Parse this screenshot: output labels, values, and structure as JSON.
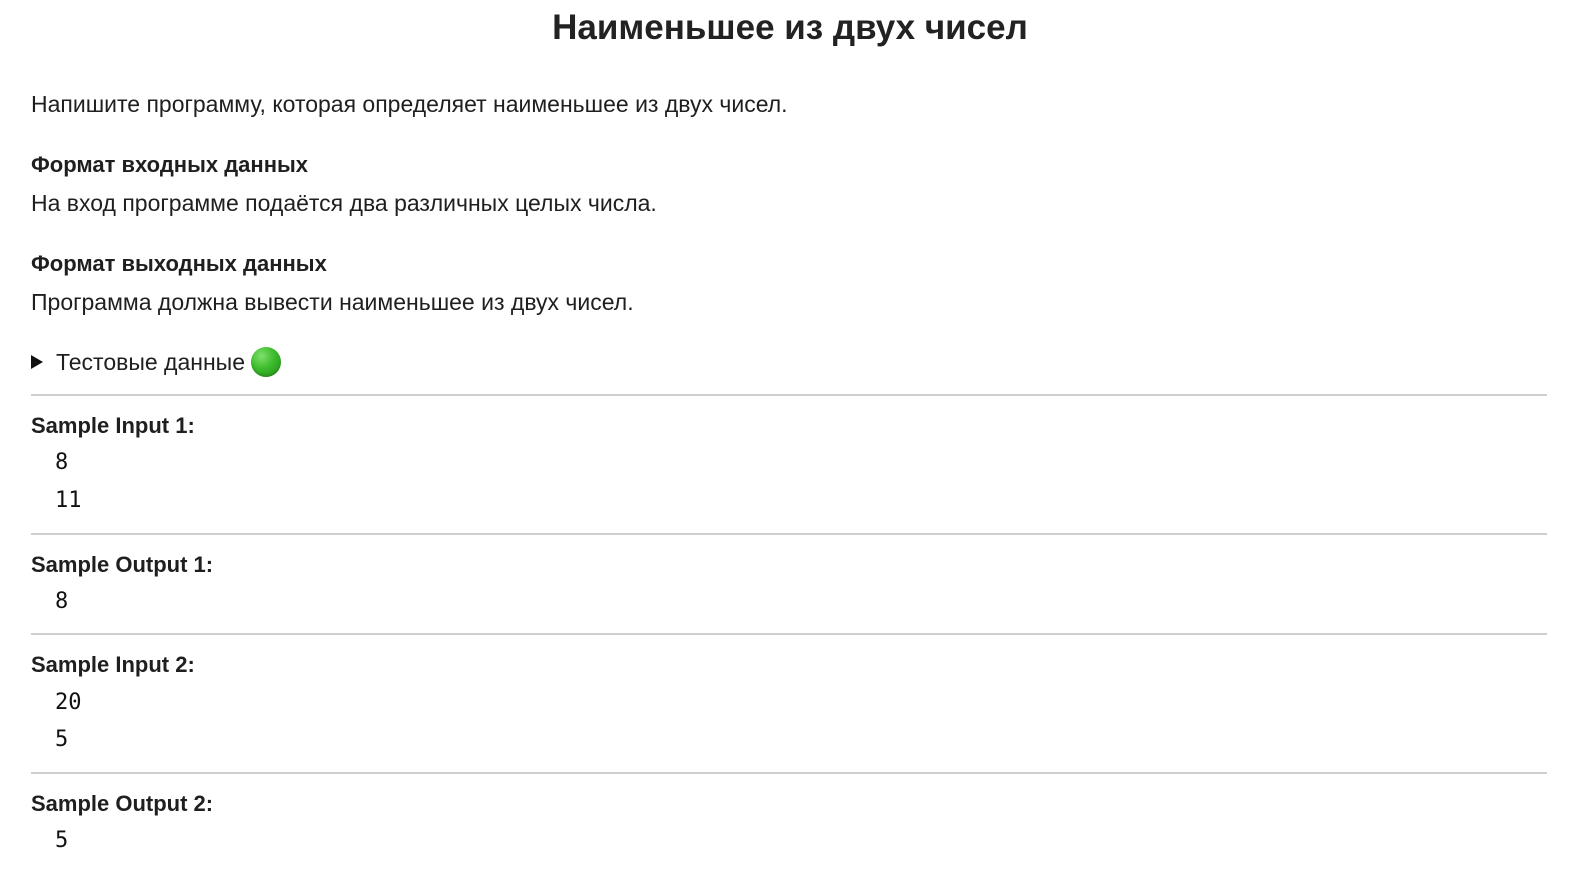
{
  "title": "Наименьшее из двух чисел",
  "description": "Напишите программу, которая определяет наименьшее из двух чисел.",
  "input_format": {
    "heading": "Формат входных данных",
    "text": "На вход программе подаётся два различных целых числа."
  },
  "output_format": {
    "heading": "Формат выходных данных",
    "text": "Программа должна вывести наименьшее из двух чисел."
  },
  "test_data": {
    "label": "Тестовые данные",
    "status_icon": "green-circle-icon",
    "status_color": "#3dbb2c"
  },
  "samples": [
    {
      "title": "Sample Input 1:",
      "lines": [
        "8",
        "11"
      ]
    },
    {
      "title": "Sample Output 1:",
      "lines": [
        "8"
      ]
    },
    {
      "title": "Sample Input 2:",
      "lines": [
        "20",
        "5"
      ]
    },
    {
      "title": "Sample Output 2:",
      "lines": [
        "5"
      ]
    }
  ]
}
